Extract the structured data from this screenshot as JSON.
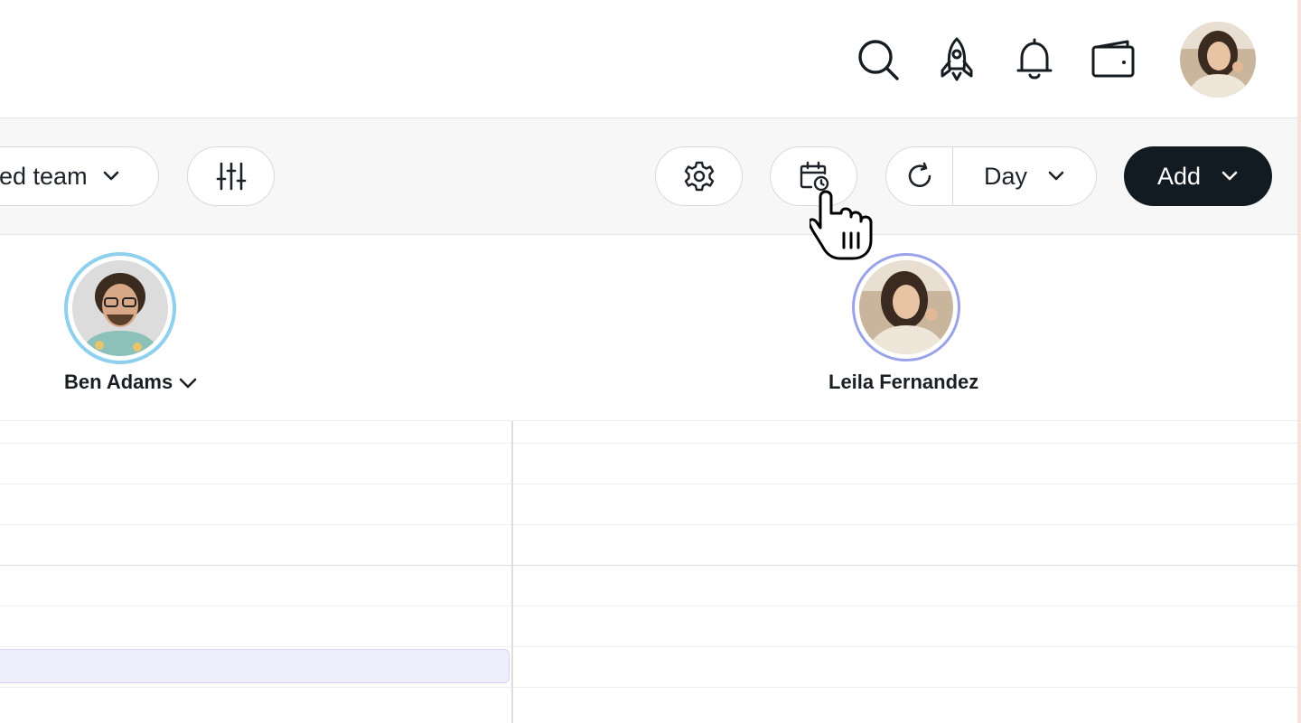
{
  "header": {
    "icons": [
      "search-icon",
      "rocket-icon",
      "bell-icon",
      "wallet-icon"
    ]
  },
  "toolbar": {
    "team_select_label": "ed team",
    "view_select_label": "Day",
    "add_button_label": "Add"
  },
  "staff": [
    {
      "name": "Ben Adams",
      "ring_color": "#8fd0ef",
      "has_dropdown": true
    },
    {
      "name": "Leila Fernandez",
      "ring_color": "#9aa3ea",
      "has_dropdown": false
    }
  ],
  "colors": {
    "primary_dark": "#121b21",
    "slot_highlight": "#eeeefd"
  }
}
